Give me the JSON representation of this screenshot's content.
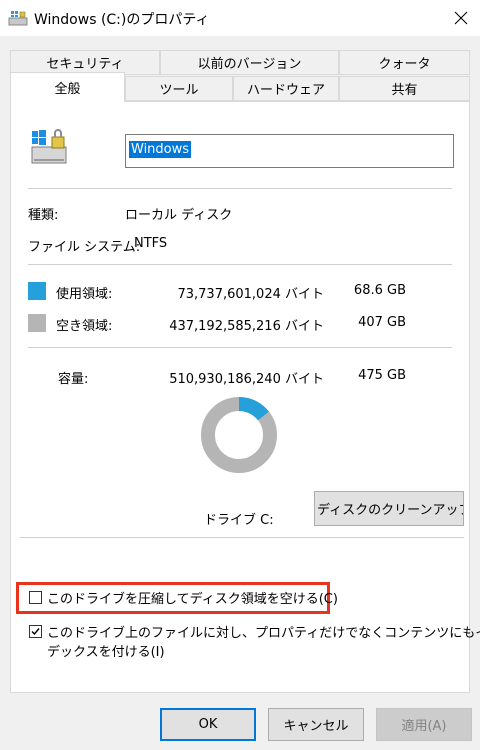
{
  "window": {
    "title": "Windows  (C:)のプロパティ",
    "close_icon": "close-icon",
    "app_icon": "drive-properties-icon"
  },
  "tabs": {
    "row1": [
      "セキュリティ",
      "以前のバージョン",
      "クォータ"
    ],
    "row2": [
      "全般",
      "ツール",
      "ハードウェア",
      "共有"
    ],
    "active": "全般"
  },
  "general": {
    "drive_name": "Windows",
    "type_label": "種類:",
    "type_value": "ローカル ディスク",
    "fs_label": "ファイル システム:",
    "fs_value": "NTFS",
    "used_label": "使用領域:",
    "used_bytes": "73,737,601,024 バイト",
    "used_size": "68.6 GB",
    "free_label": "空き領域:",
    "free_bytes": "437,192,585,216 バイト",
    "free_size": "407 GB",
    "capacity_label": "容量:",
    "capacity_bytes": "510,930,186,240 バイト",
    "capacity_size": "475 GB",
    "drive_label": "ドライブ C:",
    "cleanup_button": "ディスクのクリーンアップ(D)",
    "compress_option": "このドライブを圧縮してディスク領域を空ける(C)",
    "compress_checked": false,
    "index_option_line1": "このドライブ上のファイルに対し、プロパティだけでなくコンテンツにもイン",
    "index_option_line2": "デックスを付ける(I)",
    "index_checked": true
  },
  "colors": {
    "used": "#26a0da",
    "free": "#b5b5b5",
    "highlight": "#e8341c",
    "accent": "#0078d7"
  },
  "chart_data": {
    "type": "pie",
    "style": "donut",
    "categories": [
      "使用領域",
      "空き領域"
    ],
    "values": [
      68.6,
      407
    ],
    "unit": "GB"
  },
  "buttons": {
    "ok": "OK",
    "cancel": "キャンセル",
    "apply": "適用(A)"
  }
}
